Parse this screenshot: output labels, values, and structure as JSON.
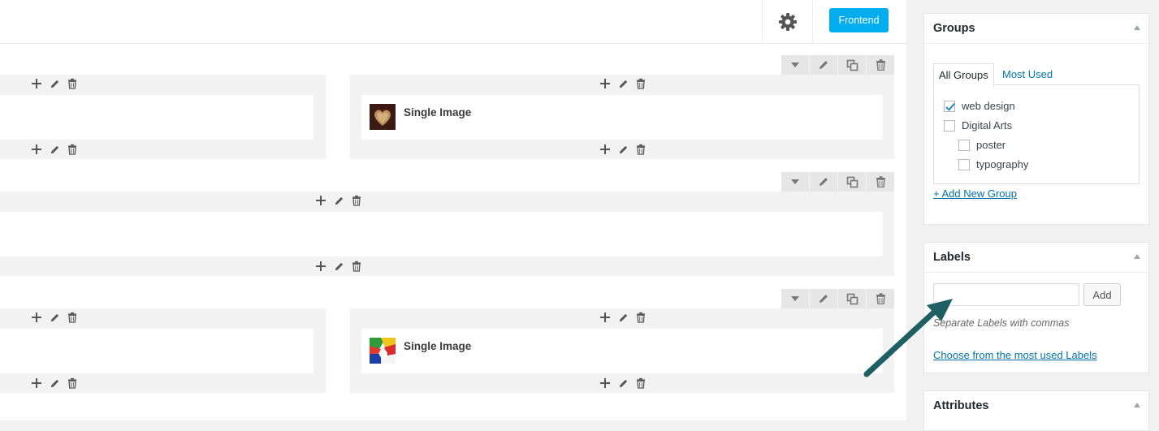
{
  "toolbar": {
    "settings_icon": "gear-icon",
    "frontend_label": "Frontend"
  },
  "row_controls_icons": [
    "caret-down-icon",
    "pencil-icon",
    "copy-icon",
    "trash-icon"
  ],
  "element_controls_icons": [
    "plus-icon",
    "pencil-icon",
    "trash-icon"
  ],
  "elements": [
    {
      "title": "Single Image",
      "thumbnail": "heart-image-thumbnail"
    },
    {
      "title": "Single Image",
      "thumbnail": "colorful-image-thumbnail"
    }
  ],
  "sidebar": {
    "groups": {
      "title": "Groups",
      "tabs": [
        "All Groups",
        "Most Used"
      ],
      "items": [
        {
          "label": "web design",
          "checked": true
        },
        {
          "label": "Digital Arts",
          "checked": false
        },
        {
          "label": "poster",
          "checked": false
        },
        {
          "label": "typography",
          "checked": false
        }
      ],
      "add_link": "+ Add New Group"
    },
    "labels": {
      "title": "Labels",
      "input_value": "",
      "add_button": "Add",
      "hint": "Separate Labels with commas",
      "choose_link": "Choose from the most used Labels"
    },
    "attributes": {
      "title": "Attributes"
    }
  },
  "colors": {
    "accent": "#00aef0",
    "link": "#0073aa",
    "arrow": "#1f5f63"
  }
}
